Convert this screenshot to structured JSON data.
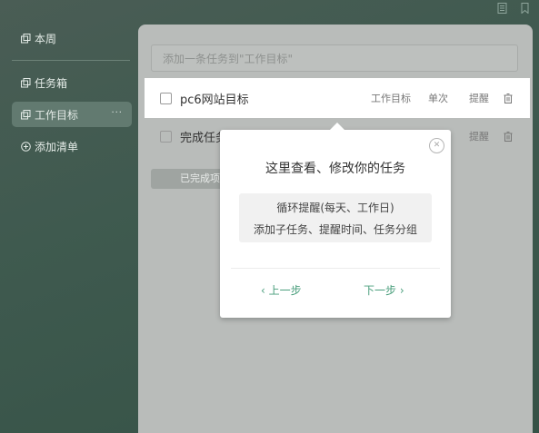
{
  "sidebar": {
    "items": [
      {
        "label": "本周",
        "icon": "copy-icon"
      },
      {
        "label": "任务箱",
        "icon": "copy-icon"
      },
      {
        "label": "工作目标",
        "icon": "copy-icon",
        "more": "···"
      },
      {
        "label": "添加清单",
        "icon": "plus-circle-icon"
      }
    ]
  },
  "search": {
    "placeholder": "添加一条任务到\"工作目标\""
  },
  "tasks": [
    {
      "title": "pc6网站目标",
      "list": "工作目标",
      "repeat": "单次",
      "remind": "提醒"
    },
    {
      "title": "完成任务",
      "remind": "提醒"
    }
  ],
  "done_button": "已完成项",
  "guide": {
    "title": "这里查看、修改你的任务",
    "tips": [
      "循环提醒(每天、工作日)",
      "添加子任务、提醒时间、任务分组"
    ],
    "prev": "上一步",
    "next": "下一步"
  },
  "colors": {
    "accent": "#4a9e7c",
    "sidebar_bg": "#3f5a4f"
  }
}
